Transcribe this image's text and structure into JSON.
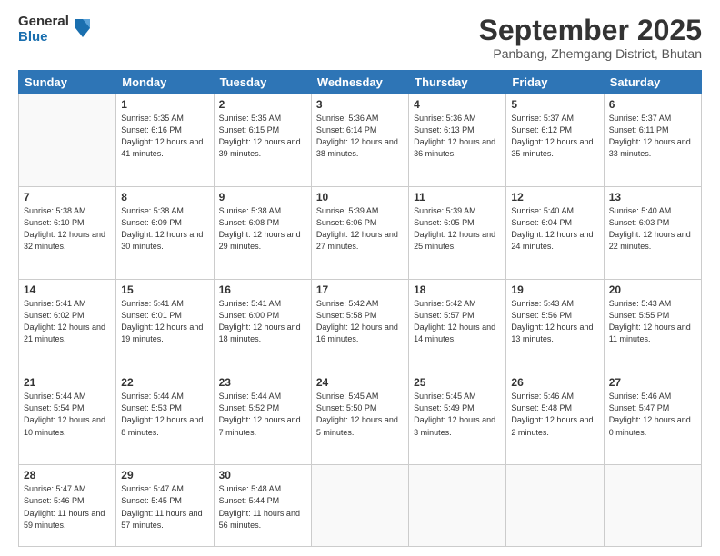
{
  "logo": {
    "general": "General",
    "blue": "Blue"
  },
  "title": "September 2025",
  "location": "Panbang, Zhemgang District, Bhutan",
  "days_of_week": [
    "Sunday",
    "Monday",
    "Tuesday",
    "Wednesday",
    "Thursday",
    "Friday",
    "Saturday"
  ],
  "weeks": [
    [
      {
        "day": "",
        "info": ""
      },
      {
        "day": "1",
        "info": "Sunrise: 5:35 AM\nSunset: 6:16 PM\nDaylight: 12 hours\nand 41 minutes."
      },
      {
        "day": "2",
        "info": "Sunrise: 5:35 AM\nSunset: 6:15 PM\nDaylight: 12 hours\nand 39 minutes."
      },
      {
        "day": "3",
        "info": "Sunrise: 5:36 AM\nSunset: 6:14 PM\nDaylight: 12 hours\nand 38 minutes."
      },
      {
        "day": "4",
        "info": "Sunrise: 5:36 AM\nSunset: 6:13 PM\nDaylight: 12 hours\nand 36 minutes."
      },
      {
        "day": "5",
        "info": "Sunrise: 5:37 AM\nSunset: 6:12 PM\nDaylight: 12 hours\nand 35 minutes."
      },
      {
        "day": "6",
        "info": "Sunrise: 5:37 AM\nSunset: 6:11 PM\nDaylight: 12 hours\nand 33 minutes."
      }
    ],
    [
      {
        "day": "7",
        "info": "Sunrise: 5:38 AM\nSunset: 6:10 PM\nDaylight: 12 hours\nand 32 minutes."
      },
      {
        "day": "8",
        "info": "Sunrise: 5:38 AM\nSunset: 6:09 PM\nDaylight: 12 hours\nand 30 minutes."
      },
      {
        "day": "9",
        "info": "Sunrise: 5:38 AM\nSunset: 6:08 PM\nDaylight: 12 hours\nand 29 minutes."
      },
      {
        "day": "10",
        "info": "Sunrise: 5:39 AM\nSunset: 6:06 PM\nDaylight: 12 hours\nand 27 minutes."
      },
      {
        "day": "11",
        "info": "Sunrise: 5:39 AM\nSunset: 6:05 PM\nDaylight: 12 hours\nand 25 minutes."
      },
      {
        "day": "12",
        "info": "Sunrise: 5:40 AM\nSunset: 6:04 PM\nDaylight: 12 hours\nand 24 minutes."
      },
      {
        "day": "13",
        "info": "Sunrise: 5:40 AM\nSunset: 6:03 PM\nDaylight: 12 hours\nand 22 minutes."
      }
    ],
    [
      {
        "day": "14",
        "info": "Sunrise: 5:41 AM\nSunset: 6:02 PM\nDaylight: 12 hours\nand 21 minutes."
      },
      {
        "day": "15",
        "info": "Sunrise: 5:41 AM\nSunset: 6:01 PM\nDaylight: 12 hours\nand 19 minutes."
      },
      {
        "day": "16",
        "info": "Sunrise: 5:41 AM\nSunset: 6:00 PM\nDaylight: 12 hours\nand 18 minutes."
      },
      {
        "day": "17",
        "info": "Sunrise: 5:42 AM\nSunset: 5:58 PM\nDaylight: 12 hours\nand 16 minutes."
      },
      {
        "day": "18",
        "info": "Sunrise: 5:42 AM\nSunset: 5:57 PM\nDaylight: 12 hours\nand 14 minutes."
      },
      {
        "day": "19",
        "info": "Sunrise: 5:43 AM\nSunset: 5:56 PM\nDaylight: 12 hours\nand 13 minutes."
      },
      {
        "day": "20",
        "info": "Sunrise: 5:43 AM\nSunset: 5:55 PM\nDaylight: 12 hours\nand 11 minutes."
      }
    ],
    [
      {
        "day": "21",
        "info": "Sunrise: 5:44 AM\nSunset: 5:54 PM\nDaylight: 12 hours\nand 10 minutes."
      },
      {
        "day": "22",
        "info": "Sunrise: 5:44 AM\nSunset: 5:53 PM\nDaylight: 12 hours\nand 8 minutes."
      },
      {
        "day": "23",
        "info": "Sunrise: 5:44 AM\nSunset: 5:52 PM\nDaylight: 12 hours\nand 7 minutes."
      },
      {
        "day": "24",
        "info": "Sunrise: 5:45 AM\nSunset: 5:50 PM\nDaylight: 12 hours\nand 5 minutes."
      },
      {
        "day": "25",
        "info": "Sunrise: 5:45 AM\nSunset: 5:49 PM\nDaylight: 12 hours\nand 3 minutes."
      },
      {
        "day": "26",
        "info": "Sunrise: 5:46 AM\nSunset: 5:48 PM\nDaylight: 12 hours\nand 2 minutes."
      },
      {
        "day": "27",
        "info": "Sunrise: 5:46 AM\nSunset: 5:47 PM\nDaylight: 12 hours\nand 0 minutes."
      }
    ],
    [
      {
        "day": "28",
        "info": "Sunrise: 5:47 AM\nSunset: 5:46 PM\nDaylight: 11 hours\nand 59 minutes."
      },
      {
        "day": "29",
        "info": "Sunrise: 5:47 AM\nSunset: 5:45 PM\nDaylight: 11 hours\nand 57 minutes."
      },
      {
        "day": "30",
        "info": "Sunrise: 5:48 AM\nSunset: 5:44 PM\nDaylight: 11 hours\nand 56 minutes."
      },
      {
        "day": "",
        "info": ""
      },
      {
        "day": "",
        "info": ""
      },
      {
        "day": "",
        "info": ""
      },
      {
        "day": "",
        "info": ""
      }
    ]
  ]
}
